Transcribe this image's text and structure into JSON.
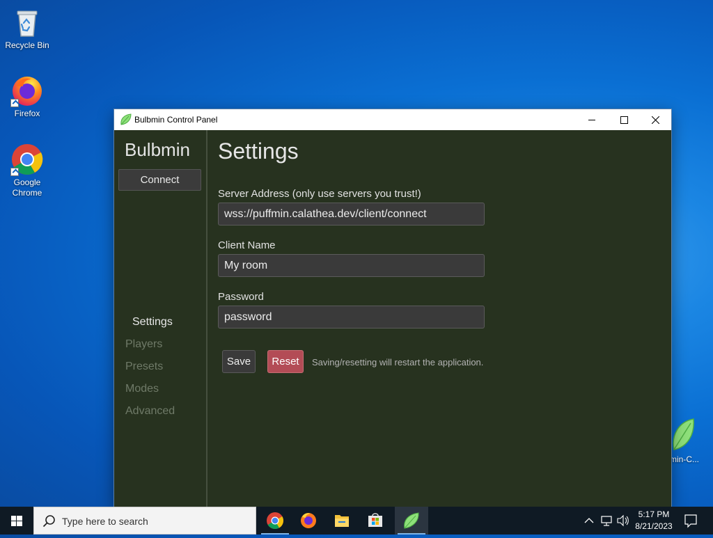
{
  "desktop": {
    "icons": [
      {
        "label": "Recycle Bin"
      },
      {
        "label": "Firefox"
      },
      {
        "label": "Google Chrome"
      }
    ],
    "right_icon_label": "min-C..."
  },
  "window": {
    "title": "Bulbmin Control Panel",
    "sidebar": {
      "brand": "Bulbmin",
      "connect_label": "Connect",
      "nav": [
        {
          "label": "Settings",
          "active": true
        },
        {
          "label": "Players",
          "active": false
        },
        {
          "label": "Presets",
          "active": false
        },
        {
          "label": "Modes",
          "active": false
        },
        {
          "label": "Advanced",
          "active": false
        }
      ]
    },
    "settings": {
      "title": "Settings",
      "server_address": {
        "label": "Server Address (only use servers you trust!)",
        "value": "wss://puffmin.calathea.dev/client/connect"
      },
      "client_name": {
        "label": "Client Name",
        "value": "My room"
      },
      "password": {
        "label": "Password",
        "value": "password"
      },
      "save_label": "Save",
      "reset_label": "Reset",
      "hint": "Saving/resetting will restart the application."
    }
  },
  "taskbar": {
    "search_placeholder": "Type here to search",
    "apps": [
      "chrome-icon",
      "firefox-icon",
      "file-explorer-icon",
      "store-icon",
      "bulbmin-icon"
    ],
    "time": "5:17 PM",
    "date": "8/21/2023"
  },
  "colors": {
    "window_bg": "#27321f",
    "reset_accent": "#b34c56",
    "nav_inactive": "#6f7a68"
  }
}
